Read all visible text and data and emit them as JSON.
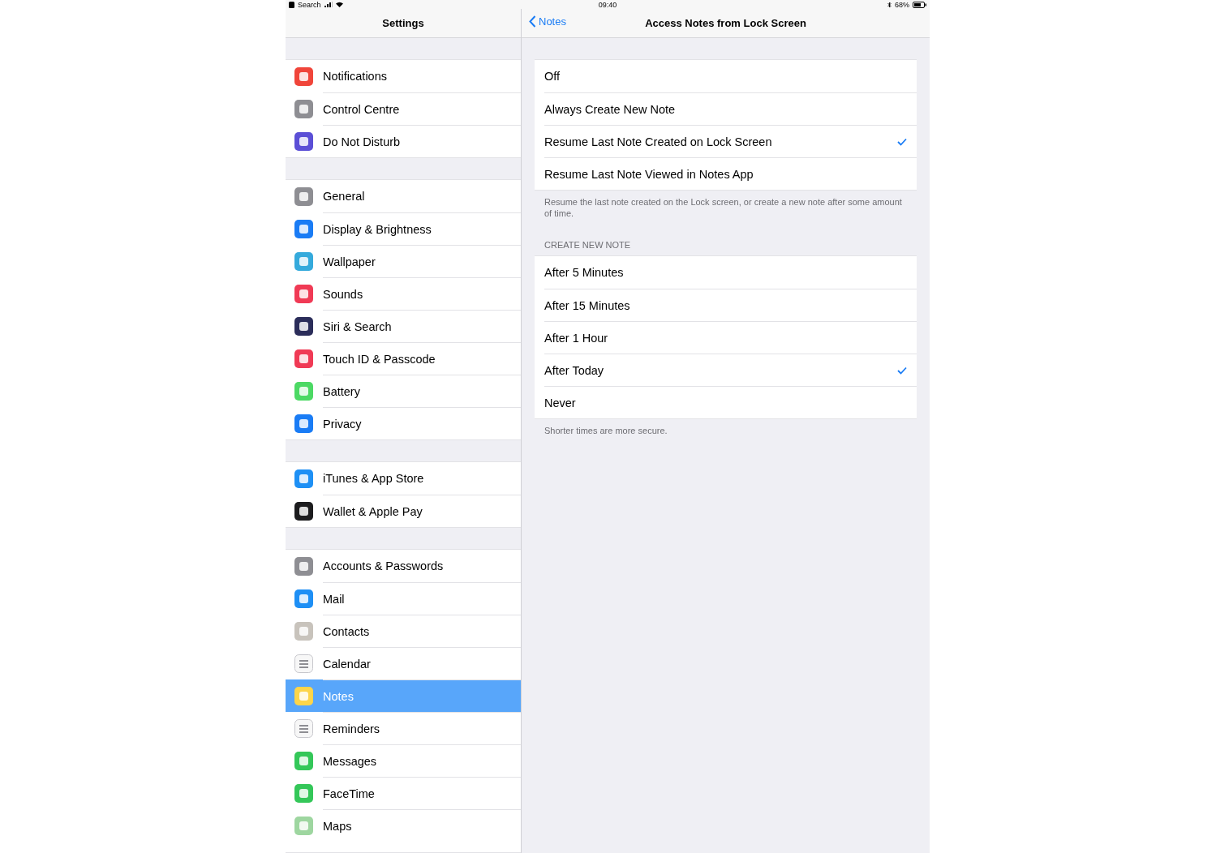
{
  "status_bar": {
    "back_app": "Search",
    "time": "09:40",
    "battery": "68%"
  },
  "sidebar": {
    "title": "Settings",
    "groups": [
      {
        "items": [
          {
            "label": "Notifications",
            "color": "#f0453a",
            "selected": false
          },
          {
            "label": "Control Centre",
            "color": "#8e8e93",
            "selected": false
          },
          {
            "label": "Do Not Disturb",
            "color": "#5b4fd6",
            "selected": false
          }
        ]
      },
      {
        "items": [
          {
            "label": "General",
            "color": "#8e8e93",
            "selected": false
          },
          {
            "label": "Display & Brightness",
            "color": "#1a7cf5",
            "selected": false
          },
          {
            "label": "Wallpaper",
            "color": "#35aadc",
            "selected": false
          },
          {
            "label": "Sounds",
            "color": "#f03a55",
            "selected": false
          },
          {
            "label": "Siri & Search",
            "color": "#2b2d5a",
            "selected": false
          },
          {
            "label": "Touch ID & Passcode",
            "color": "#f03a55",
            "selected": false
          },
          {
            "label": "Battery",
            "color": "#4cd964",
            "selected": false
          },
          {
            "label": "Privacy",
            "color": "#1a7cf5",
            "selected": false
          }
        ]
      },
      {
        "items": [
          {
            "label": "iTunes & App Store",
            "color": "#1e90f5",
            "selected": false
          },
          {
            "label": "Wallet & Apple Pay",
            "color": "#1c1c1e",
            "selected": false
          }
        ]
      },
      {
        "items": [
          {
            "label": "Accounts & Passwords",
            "color": "#8e8e93",
            "selected": false
          },
          {
            "label": "Mail",
            "color": "#1e8ff5",
            "selected": false
          },
          {
            "label": "Contacts",
            "color": "#c8c3bc",
            "selected": false
          },
          {
            "label": "Calendar",
            "color": "#f7f7f7",
            "selected": false
          },
          {
            "label": "Notes",
            "color": "#fdd54a",
            "selected": true
          },
          {
            "label": "Reminders",
            "color": "#f7f7f7",
            "selected": false
          },
          {
            "label": "Messages",
            "color": "#34c759",
            "selected": false
          },
          {
            "label": "FaceTime",
            "color": "#34c759",
            "selected": false
          },
          {
            "label": "Maps",
            "color": "#9ed6a0",
            "selected": false
          }
        ]
      }
    ]
  },
  "detail": {
    "back": "Notes",
    "title": "Access Notes from Lock Screen",
    "sections": [
      {
        "options": [
          {
            "label": "Off",
            "selected": false
          },
          {
            "label": "Always Create New Note",
            "selected": false
          },
          {
            "label": "Resume Last Note Created on Lock Screen",
            "selected": true
          },
          {
            "label": "Resume Last Note Viewed in Notes App",
            "selected": false
          }
        ],
        "footer": "Resume the last note created on the Lock screen, or create a new note after some amount of time."
      },
      {
        "header": "CREATE NEW NOTE",
        "options": [
          {
            "label": "After 5 Minutes",
            "selected": false
          },
          {
            "label": "After 15 Minutes",
            "selected": false
          },
          {
            "label": "After 1 Hour",
            "selected": false
          },
          {
            "label": "After Today",
            "selected": true
          },
          {
            "label": "Never",
            "selected": false
          }
        ],
        "footer": "Shorter times are more secure."
      }
    ]
  }
}
